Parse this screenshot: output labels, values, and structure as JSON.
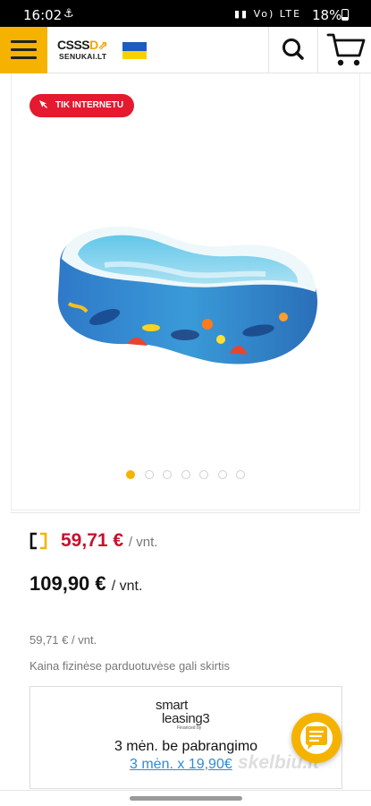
{
  "status_bar": {
    "time": "16:02",
    "network": "Vo) LTE",
    "battery": "18%"
  },
  "header": {
    "logo_word_a": "CSSS",
    "logo_word_b": "D",
    "logo_sub": "SENUKAI.LT"
  },
  "product": {
    "badge": "TIK INTERNETU",
    "gallery_count": 7,
    "gallery_active_index": 0
  },
  "prices": {
    "online_price": "59,71 €",
    "online_unit": "/ vnt.",
    "regular_price": "109,90 €",
    "regular_unit": "/ vnt.",
    "small_price": "59,71 € / vnt.",
    "store_note": "Kaina fizinėse parduotuvėse gali skirtis"
  },
  "leasing": {
    "logo_line1": "smart",
    "logo_line2": "leasing3",
    "logo_line3": "Financed by",
    "title": "3 mėn. be pabrangimo",
    "link": "3 mėn. x 19,90€"
  },
  "watermark": "skelbiu.lt",
  "colors": {
    "accent": "#f5b300",
    "sale_red": "#c8102e",
    "badge_red": "#e5192f",
    "link_blue": "#2f8bd8"
  }
}
